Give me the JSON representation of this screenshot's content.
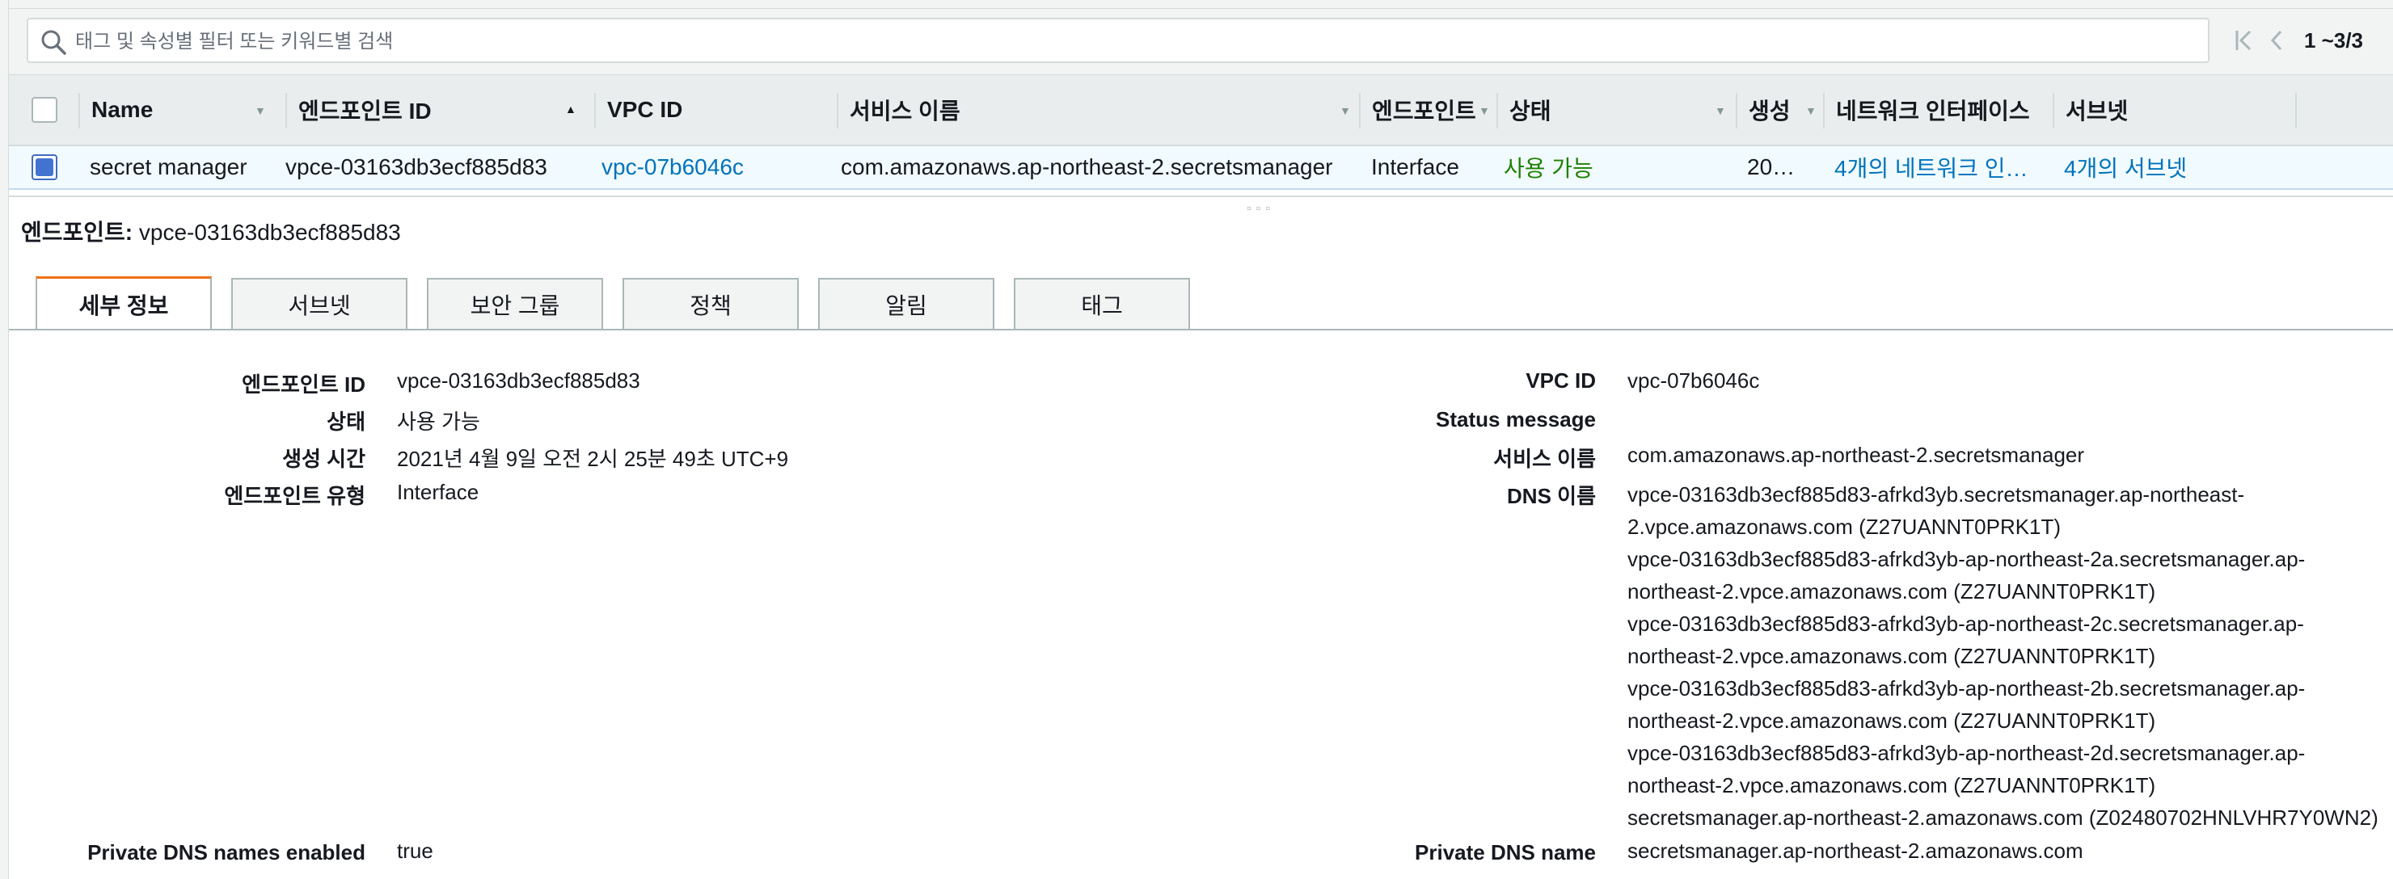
{
  "search": {
    "placeholder": "태그 및 속성별 필터 또는 키워드별 검색"
  },
  "pager": {
    "count": "1 ~3/3"
  },
  "table": {
    "columns": [
      "Name",
      "엔드포인트 ID",
      "VPC ID",
      "서비스 이름",
      "엔드포인트",
      "상태",
      "생성",
      "네트워크 인터페이스",
      "서브넷"
    ],
    "row": {
      "name": "secret manager",
      "endpoint_id": "vpce-03163db3ecf885d83",
      "vpc_id": "vpc-07b6046c",
      "service_name": "com.amazonaws.ap-northeast-2.secretsmanager",
      "endpoint_type": "Interface",
      "status": "사용 가능",
      "created": "20…",
      "network_interfaces": "4개의 네트워크 인…",
      "subnets": "4개의 서브넷"
    }
  },
  "detail": {
    "heading_label": "엔드포인트:",
    "heading_value": "vpce-03163db3ecf885d83",
    "tabs": [
      "세부 정보",
      "서브넷",
      "보안 그룹",
      "정책",
      "알림",
      "태그"
    ],
    "left": {
      "endpoint_id_label": "엔드포인트 ID",
      "endpoint_id": "vpce-03163db3ecf885d83",
      "status_label": "상태",
      "status": "사용 가능",
      "created_label": "생성 시간",
      "created": "2021년 4월 9일 오전 2시 25분 49초 UTC+9",
      "type_label": "엔드포인트 유형",
      "type": "Interface",
      "private_dns_enabled_label": "Private DNS names enabled",
      "private_dns_enabled": "true"
    },
    "right": {
      "vpc_label": "VPC ID",
      "vpc": "vpc-07b6046c",
      "status_message_label": "Status message",
      "service_label": "서비스 이름",
      "service": "com.amazonaws.ap-northeast-2.secretsmanager",
      "dns_label": "DNS 이름",
      "dns_names": [
        "vpce-03163db3ecf885d83-afrkd3yb.secretsmanager.ap-northeast-2.vpce.amazonaws.com (Z27UANNT0PRK1T)",
        "vpce-03163db3ecf885d83-afrkd3yb-ap-northeast-2a.secretsmanager.ap-northeast-2.vpce.amazonaws.com (Z27UANNT0PRK1T)",
        "vpce-03163db3ecf885d83-afrkd3yb-ap-northeast-2c.secretsmanager.ap-northeast-2.vpce.amazonaws.com (Z27UANNT0PRK1T)",
        "vpce-03163db3ecf885d83-afrkd3yb-ap-northeast-2b.secretsmanager.ap-northeast-2.vpce.amazonaws.com (Z27UANNT0PRK1T)",
        "vpce-03163db3ecf885d83-afrkd3yb-ap-northeast-2d.secretsmanager.ap-northeast-2.vpce.amazonaws.com (Z27UANNT0PRK1T)",
        "secretsmanager.ap-northeast-2.amazonaws.com (Z02480702HNLVHR7Y0WN2)"
      ],
      "private_dns_label": "Private DNS name",
      "private_dns": "secretsmanager.ap-northeast-2.amazonaws.com"
    }
  },
  "colors": {
    "link": "#0073bb",
    "ok": "#1d8102",
    "active_tab": "#ec7211",
    "selected_row": "#f1faff"
  }
}
